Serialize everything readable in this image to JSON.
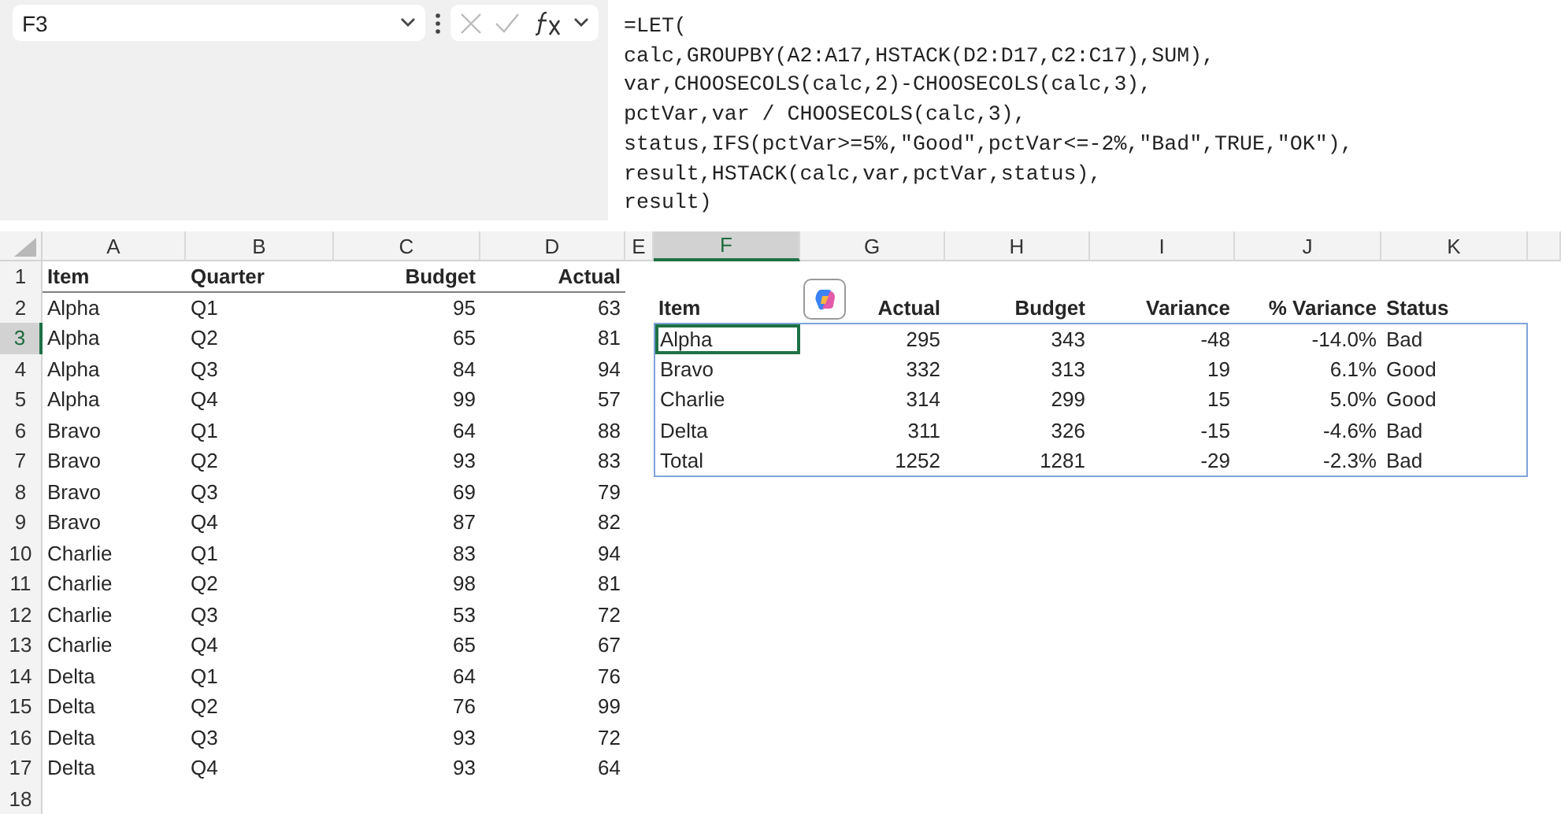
{
  "name_box": {
    "value": "F3"
  },
  "formula_bar": {
    "lines": [
      "=LET(",
      "calc,GROUPBY(A2:A17,HSTACK(D2:D17,C2:C17),SUM),",
      "var,CHOOSECOLS(calc,2)-CHOOSECOLS(calc,3),",
      "pctVar,var / CHOOSECOLS(calc,3),",
      "status,IFS(pctVar>=5%,\"Good\",pctVar<=-2%,\"Bad\",TRUE,\"OK\"),",
      "result,HSTACK(calc,var,pctVar,status),",
      "result)"
    ]
  },
  "columns": [
    {
      "label": "A",
      "selected": false
    },
    {
      "label": "B",
      "selected": false
    },
    {
      "label": "C",
      "selected": false
    },
    {
      "label": "D",
      "selected": false
    },
    {
      "label": "E",
      "selected": false
    },
    {
      "label": "F",
      "selected": true
    },
    {
      "label": "G",
      "selected": false
    },
    {
      "label": "H",
      "selected": false
    },
    {
      "label": "I",
      "selected": false
    },
    {
      "label": "J",
      "selected": false
    },
    {
      "label": "K",
      "selected": false
    }
  ],
  "rows": [
    {
      "label": "1",
      "selected": false
    },
    {
      "label": "2",
      "selected": false
    },
    {
      "label": "3",
      "selected": true
    },
    {
      "label": "4",
      "selected": false
    },
    {
      "label": "5",
      "selected": false
    },
    {
      "label": "6",
      "selected": false
    },
    {
      "label": "7",
      "selected": false
    },
    {
      "label": "8",
      "selected": false
    },
    {
      "label": "9",
      "selected": false
    },
    {
      "label": "10",
      "selected": false
    },
    {
      "label": "11",
      "selected": false
    },
    {
      "label": "12",
      "selected": false
    },
    {
      "label": "13",
      "selected": false
    },
    {
      "label": "14",
      "selected": false
    },
    {
      "label": "15",
      "selected": false
    },
    {
      "label": "16",
      "selected": false
    },
    {
      "label": "17",
      "selected": false
    },
    {
      "label": "18",
      "selected": false
    }
  ],
  "source_table": {
    "columns": [
      {
        "label": "Item",
        "kind": "text"
      },
      {
        "label": "Quarter",
        "kind": "text"
      },
      {
        "label": "Budget",
        "kind": "number"
      },
      {
        "label": "Actual",
        "kind": "number"
      }
    ],
    "rows": [
      [
        "Alpha",
        "Q1",
        "95",
        "63"
      ],
      [
        "Alpha",
        "Q2",
        "65",
        "81"
      ],
      [
        "Alpha",
        "Q3",
        "84",
        "94"
      ],
      [
        "Alpha",
        "Q4",
        "99",
        "57"
      ],
      [
        "Bravo",
        "Q1",
        "64",
        "88"
      ],
      [
        "Bravo",
        "Q2",
        "93",
        "83"
      ],
      [
        "Bravo",
        "Q3",
        "69",
        "79"
      ],
      [
        "Bravo",
        "Q4",
        "87",
        "82"
      ],
      [
        "Charlie",
        "Q1",
        "83",
        "94"
      ],
      [
        "Charlie",
        "Q2",
        "98",
        "81"
      ],
      [
        "Charlie",
        "Q3",
        "53",
        "72"
      ],
      [
        "Charlie",
        "Q4",
        "65",
        "67"
      ],
      [
        "Delta",
        "Q1",
        "64",
        "76"
      ],
      [
        "Delta",
        "Q2",
        "76",
        "99"
      ],
      [
        "Delta",
        "Q3",
        "93",
        "72"
      ],
      [
        "Delta",
        "Q4",
        "93",
        "64"
      ]
    ]
  },
  "result_table": {
    "columns": [
      {
        "label": "Item",
        "kind": "text"
      },
      {
        "label": "Actual",
        "kind": "number"
      },
      {
        "label": "Budget",
        "kind": "number"
      },
      {
        "label": "Variance",
        "kind": "number"
      },
      {
        "label": "% Variance",
        "kind": "number"
      },
      {
        "label": "Status",
        "kind": "text"
      }
    ],
    "rows": [
      [
        "Alpha",
        "295",
        "343",
        "-48",
        "-14.0%",
        "Bad"
      ],
      [
        "Bravo",
        "332",
        "313",
        "19",
        "6.1%",
        "Good"
      ],
      [
        "Charlie",
        "314",
        "299",
        "15",
        "5.0%",
        "Good"
      ],
      [
        "Delta",
        "311",
        "326",
        "-15",
        "-4.6%",
        "Bad"
      ],
      [
        "Total",
        "1252",
        "1281",
        "-29",
        "-2.3%",
        "Bad"
      ]
    ]
  }
}
